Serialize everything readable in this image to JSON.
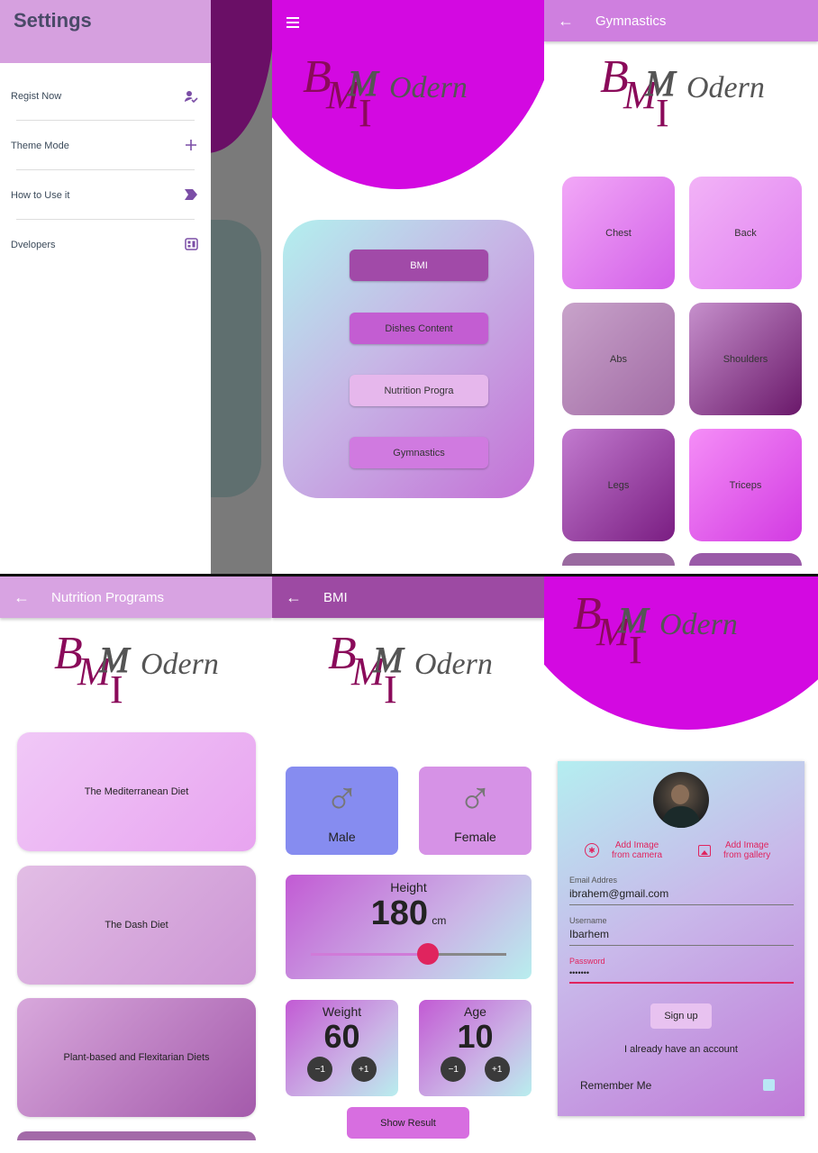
{
  "settings": {
    "title": "Settings",
    "items": [
      {
        "label": "Regist Now",
        "icon": "person-check-icon"
      },
      {
        "label": "Theme Mode",
        "icon": "plus-icon"
      },
      {
        "label": "How to Use it",
        "icon": "label-arrow-icon"
      },
      {
        "label": "Dvelopers",
        "icon": "dashboard-icon"
      }
    ]
  },
  "home": {
    "buttons": [
      "BMI",
      "Dishes Content",
      "Nutrition Progra",
      "Gymnastics"
    ]
  },
  "gymnastics": {
    "title": "Gymnastics",
    "tiles": [
      "Chest",
      "Back",
      "Abs",
      "Shoulders",
      "Legs",
      "Triceps"
    ]
  },
  "nutrition": {
    "title": "Nutrition Programs",
    "programs": [
      "The Mediterranean Diet",
      "The Dash Diet",
      "Plant-based and Flexitarian Diets"
    ]
  },
  "bmi": {
    "title": "BMI",
    "male": "Male",
    "female": "Female",
    "height_label": "Height",
    "height_value": "180",
    "height_unit": "cm",
    "height_slider_fraction": 0.6,
    "weight_label": "Weight",
    "weight_value": "60",
    "age_label": "Age",
    "age_value": "10",
    "minus": "−1",
    "plus": "+1",
    "show_result": "Show Result"
  },
  "signup": {
    "add_camera": "Add Image\nfrom camera",
    "add_gallery": "Add Image\nfrom gallery",
    "email_label": "Email Addres",
    "email_value": "ibrahem@gmail.com",
    "username_label": "Username",
    "username_value": "Ibarhem",
    "password_label": "Password",
    "password_value": "•••••••",
    "signup_button": "Sign up",
    "already": "I already have an account",
    "remember": "Remember Me"
  },
  "logo_text": "BMI Modern",
  "colors": {
    "accent": "#d309e1",
    "appbar": "#d38be0",
    "password": "#e0245e",
    "slider": "#e0245e"
  }
}
